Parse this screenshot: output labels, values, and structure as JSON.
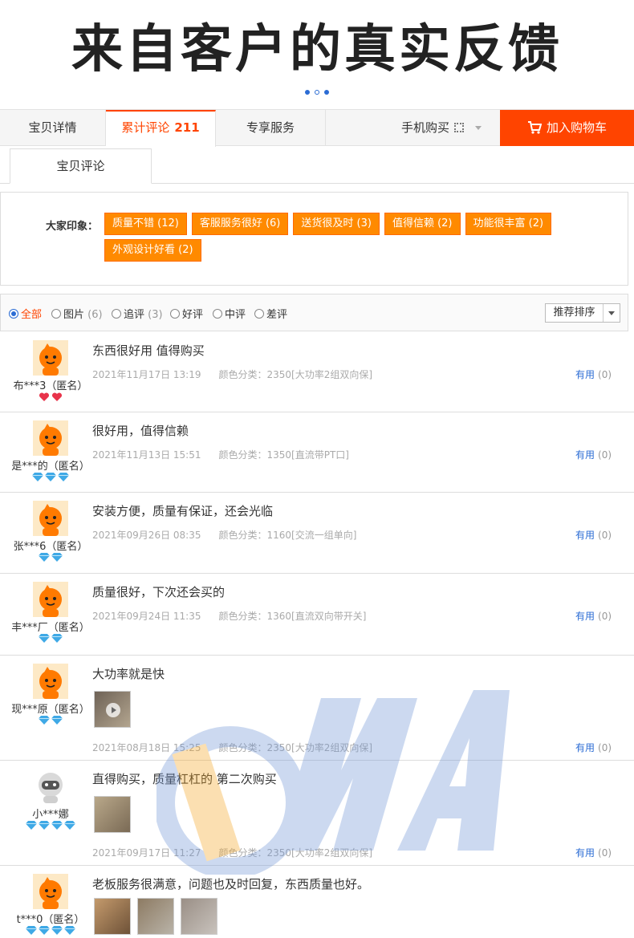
{
  "hero": {
    "title": "来自客户的真实反馈"
  },
  "tabs": {
    "items": [
      {
        "label": "宝贝详情",
        "count": ""
      },
      {
        "label": "累计评论",
        "count": "211"
      },
      {
        "label": "专享服务",
        "count": ""
      }
    ],
    "mobile": "手机购买",
    "cart": "加入购物车"
  },
  "subtab": "宝贝评论",
  "impressions": {
    "label": "大家印象：",
    "tags": [
      "质量不错 (12)",
      "客服服务很好 (6)",
      "送货很及时 (3)",
      "值得信赖 (2)",
      "功能很丰富 (2)",
      "外观设计好看 (2)"
    ]
  },
  "filter": {
    "options": [
      {
        "label": "全部",
        "count": ""
      },
      {
        "label": "图片",
        "count": "(6)"
      },
      {
        "label": "追评",
        "count": "(3)"
      },
      {
        "label": "好评",
        "count": ""
      },
      {
        "label": "中评",
        "count": ""
      },
      {
        "label": "差评",
        "count": ""
      }
    ],
    "sort": "推荐排序"
  },
  "useful_label": "有用",
  "useful_count": "(0)",
  "reviews": [
    {
      "user": "布***3（匿名）",
      "avatar": "orange-mascot",
      "badge": "heart",
      "badge_count": 2,
      "text": "东西很好用 值得购买",
      "date": "2021年11月17日 13:19",
      "sku": "颜色分类：2350[大功率2组双向保]",
      "images": 0
    },
    {
      "user": "是***的（匿名）",
      "avatar": "orange-mascot",
      "badge": "diamond",
      "badge_count": 3,
      "text": "很好用，值得信赖",
      "date": "2021年11月13日 15:51",
      "sku": "颜色分类：1350[直流带PT口]",
      "images": 0
    },
    {
      "user": "张***6（匿名）",
      "avatar": "orange-mascot",
      "badge": "diamond",
      "badge_count": 2,
      "text": "安装方便，质量有保证，还会光临",
      "date": "2021年09月26日 08:35",
      "sku": "颜色分类：1160[交流一组单向]",
      "images": 0
    },
    {
      "user": "丰***厂（匿名）",
      "avatar": "orange-mascot",
      "badge": "diamond",
      "badge_count": 2,
      "text": "质量很好，下次还会买的",
      "date": "2021年09月24日 11:35",
      "sku": "颜色分类：1360[直流双向带开关]",
      "images": 0
    },
    {
      "user": "现***原（匿名）",
      "avatar": "orange-mascot",
      "badge": "diamond",
      "badge_count": 2,
      "text": "大功率就是快",
      "date": "2021年08月18日 15:25",
      "sku": "颜色分类：2350[大功率2组双向保]",
      "images": 1
    },
    {
      "user": "小***娜",
      "avatar": "gray-robot",
      "badge": "diamond",
      "badge_count": 4,
      "text": "直得购买，质量杠杠的 第二次购买",
      "date": "2021年09月17日 11:27",
      "sku": "颜色分类：2350[大功率2组双向保]",
      "images": 1
    },
    {
      "user": "t***0（匿名）",
      "avatar": "orange-mascot",
      "badge": "diamond",
      "badge_count": 4,
      "text": "老板服务很满意，问题也及时回复，东西质量也好。",
      "date": "",
      "sku": "",
      "images": 3
    }
  ],
  "colors": {
    "accent": "#ff4400",
    "tag": "#ff8a00",
    "link": "#2b6cd4",
    "watermark_blue": "#6f95d6",
    "watermark_orange": "#f5a623"
  }
}
